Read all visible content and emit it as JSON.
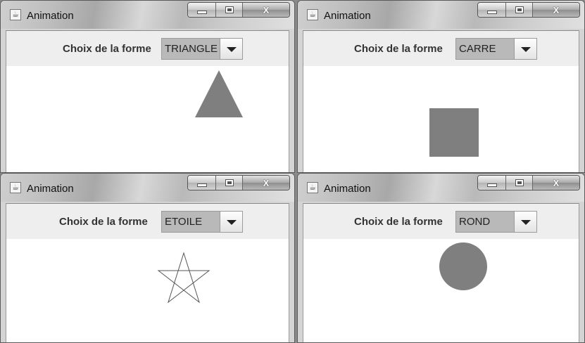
{
  "windows": [
    {
      "title": "Animation",
      "label": "Choix de la forme",
      "selected": "TRIANGLE",
      "shape": "triangle"
    },
    {
      "title": "Animation",
      "label": "Choix de la forme",
      "selected": "CARRE",
      "shape": "square"
    },
    {
      "title": "Animation",
      "label": "Choix de la forme",
      "selected": "ETOILE",
      "shape": "star"
    },
    {
      "title": "Animation",
      "label": "Choix de la forme",
      "selected": "ROND",
      "shape": "circle"
    }
  ],
  "colors": {
    "shape_fill": "#7f7f7f",
    "star_stroke": "#555555"
  },
  "icons": {
    "app": "java-cup-icon",
    "minimize": "minimize-icon",
    "maximize": "maximize-icon",
    "close": "close-icon"
  }
}
